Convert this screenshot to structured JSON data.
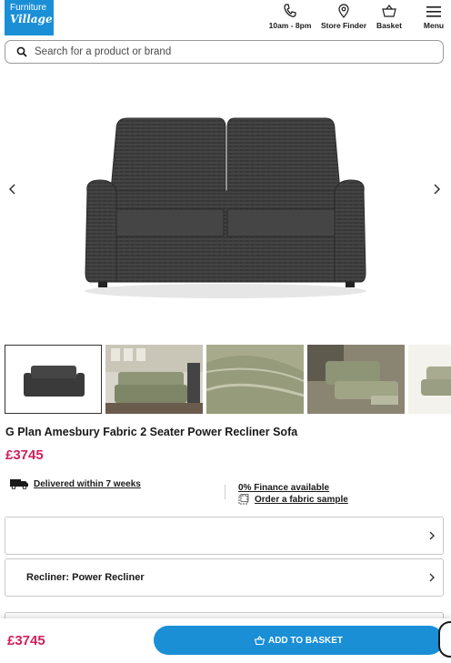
{
  "header": {
    "logo_line1": "Furniture",
    "logo_line2": "Village",
    "phone_label": "10am - 8pm",
    "store_label": "Store Finder",
    "basket_label": "Basket",
    "menu_label": "Menu"
  },
  "search": {
    "placeholder": "Search for a product or brand"
  },
  "product": {
    "title": "G Plan Amesbury Fabric 2 Seater Power Recliner Sofa",
    "price": "£3745",
    "delivery": "Delivered within 7 weeks",
    "finance": "0% Finance available",
    "fabric_sample": "Order a fabric sample"
  },
  "options": [
    {
      "label": ""
    },
    {
      "label": "Recliner: Power Recliner"
    }
  ],
  "sticky": {
    "price": "£3745",
    "button": "ADD TO BASKET"
  },
  "colors": {
    "brand_blue": "#1a8fd6",
    "price_pink": "#d0205a"
  },
  "thumbnails": [
    "charcoal-sofa",
    "green-sofa-room",
    "fabric-closeup",
    "recliner-open",
    "green-sofa-partial"
  ]
}
